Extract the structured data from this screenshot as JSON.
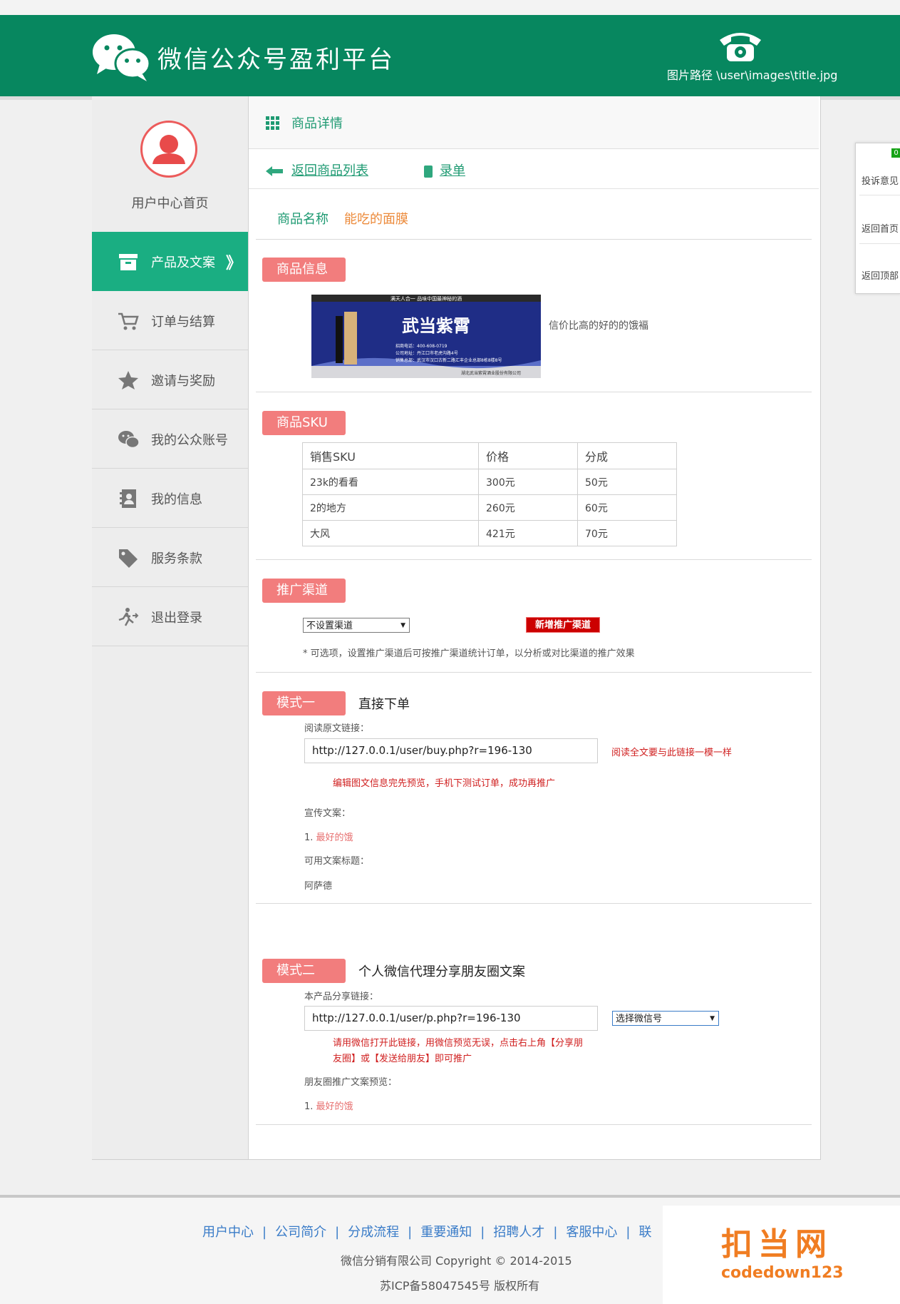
{
  "header": {
    "app_title": "微信公众号盈利平台",
    "image_path": "图片路径 \\user\\images\\title.jpg"
  },
  "sidebar": {
    "home_label": "用户中心首页",
    "items": [
      {
        "label": "产品及文案",
        "icon": "box-icon",
        "active": true,
        "chevron": "》"
      },
      {
        "label": "订单与结算",
        "icon": "cart-icon"
      },
      {
        "label": "邀请与奖励",
        "icon": "star-icon"
      },
      {
        "label": "我的公众账号",
        "icon": "wechat-icon"
      },
      {
        "label": "我的信息",
        "icon": "contacts-icon"
      },
      {
        "label": "服务条款",
        "icon": "tag-icon"
      },
      {
        "label": "退出登录",
        "icon": "exit-icon"
      }
    ]
  },
  "main": {
    "page_title": "商品详情",
    "back_link": "返回商品列表",
    "record_link": "录单",
    "product_name_label": "商品名称",
    "product_name_value": "能吃的面膜",
    "product_info": {
      "tag": "商品信息",
      "description": "信价比高的好的的饿褔",
      "image_text": {
        "top": "满天人合一   品味中国最神秘的酒",
        "brand": "武当紫霄",
        "line1": "招商电话：400-608-0719",
        "line2": "公司地址：丹江口市老虎沟路4号",
        "line3": "销售总部：武汉市汉口古新二路汇丰企业总部8栋8楼8号",
        "footer": "湖北武当紫霄酒业股份有限公司"
      }
    },
    "sku": {
      "tag": "商品SKU",
      "columns": [
        "销售SKU",
        "价格",
        "分成"
      ],
      "rows": [
        [
          "23k的看看",
          "300元",
          "50元"
        ],
        [
          "2的地方",
          "260元",
          "60元"
        ],
        [
          "大风",
          "421元",
          "70元"
        ]
      ]
    },
    "channel": {
      "tag": "推广渠道",
      "select_value": "不设置渠道",
      "add_button": "新增推广渠道",
      "hint": "* 可选项，设置推广渠道后可按推广渠道统计订单，以分析或对比渠道的推广效果"
    },
    "mode1": {
      "tag": "模式一",
      "title": "直接下单",
      "link_label": "阅读原文链接：",
      "link_value": "http://127.0.0.1/user/buy.php?r=196-130",
      "side_note": "阅读全文要与此链接一模一样",
      "note": "编辑图文信息完先预览，手机下测试订单，成功再推广",
      "copy_label": "宣传文案：",
      "copy_item_num": "1.",
      "copy_item": "最好的饿",
      "title_label": "可用文案标题：",
      "title_value": "阿萨德"
    },
    "mode2": {
      "tag": "模式二",
      "title": "个人微信代理分享朋友圈文案",
      "link_label": "本产品分享链接：",
      "link_value": "http://127.0.0.1/user/p.php?r=196-130",
      "select_value": "选择微信号",
      "note_line1": "请用微信打开此链接，用微信预览无误，点击右上角【分享朋",
      "note_line2": "友圈】或【发送给朋友】即可推广",
      "preview_label": "朋友圈推广文案预览：",
      "preview_item_num": "1.",
      "preview_item": "最好的饿"
    }
  },
  "float_panel": {
    "badge": "0",
    "items": [
      "投诉意见",
      "返回首页",
      "返回顶部"
    ]
  },
  "footer": {
    "links": [
      "用户中心",
      "公司简介",
      "分成流程",
      "重要通知",
      "招聘人才",
      "客服中心",
      "联"
    ],
    "copyright": "微信分销有限公司   Copyright © 2014-2015",
    "icp": "苏ICP备58047545号 版权所有"
  },
  "watermark": {
    "big": "扣当网",
    "small": "codedown123"
  },
  "colors": {
    "header_green": "#07875f",
    "active_green": "#1aae82",
    "link_green": "#1e9a72",
    "tag_pink": "#f27d7d",
    "warn_red": "#cc0000",
    "footer_blue": "#3a7cc8",
    "watermark_orange": "#f07d22"
  }
}
